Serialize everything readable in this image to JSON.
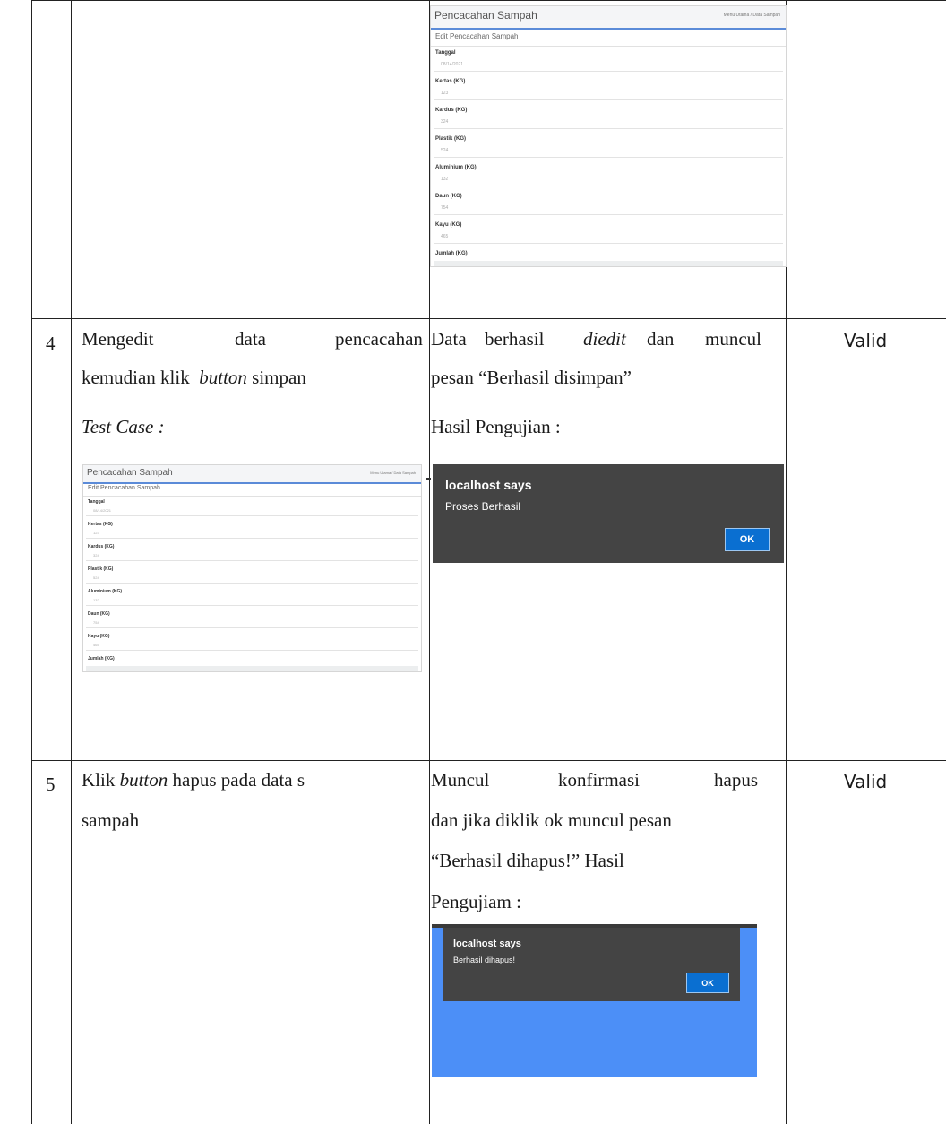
{
  "app_screenshot": {
    "title": "Pencacahan Sampah",
    "breadcrumb": "Menu Utama / Data Sampah",
    "subtitle": "Edit Pencacahan Sampah",
    "fields": [
      {
        "label": "Tanggal",
        "value": "08/14/2021"
      },
      {
        "label": "Kertas (KG)",
        "value": "123"
      },
      {
        "label": "Kardus (KG)",
        "value": "324"
      },
      {
        "label": "Plastik (KG)",
        "value": "524"
      },
      {
        "label": "Aluminium (KG)",
        "value": "132"
      },
      {
        "label": "Daun (KG)",
        "value": "754"
      },
      {
        "label": "Kayu (KG)",
        "value": "465"
      },
      {
        "label": "Jumlah (KG)",
        "value": ""
      }
    ]
  },
  "row4": {
    "number": "4",
    "step_line1_a": "Mengedit",
    "step_line1_b": "data",
    "step_line1_c": "pencacahan",
    "step_line2_a": "kemudian klik",
    "step_line2_em": "button",
    "step_line2_b": "simpan",
    "step_line3": "Test Case :",
    "result_line1_a": "Data",
    "result_line1_b": "berhasil",
    "result_line1_em": "diedit",
    "result_line1_c": "dan",
    "result_line1_d": "muncul",
    "result_line2": "pesan “Berhasil disimpan”",
    "result_line3": "Hasil Pengujian :",
    "status": "Valid",
    "dialog": {
      "title": "localhost says",
      "message": "Proses Berhasil",
      "ok": "OK"
    }
  },
  "row5": {
    "number": "5",
    "step_line1_a": "Klik",
    "step_line1_em": "button",
    "step_line1_b": "hapus pada data s",
    "step_line2": "sampah",
    "result_line1_a": "Muncul",
    "result_line1_b": "konfirmasi",
    "result_line1_c": "hapus",
    "result_line2": "dan jika diklik ok muncul pesan",
    "result_line3": "“Berhasil dihapus!” Hasil",
    "result_line4": "Pengujiam :",
    "status": "Valid",
    "dialog": {
      "title": "localhost says",
      "message": "Berhasil dihapus!",
      "ok": "OK"
    }
  }
}
